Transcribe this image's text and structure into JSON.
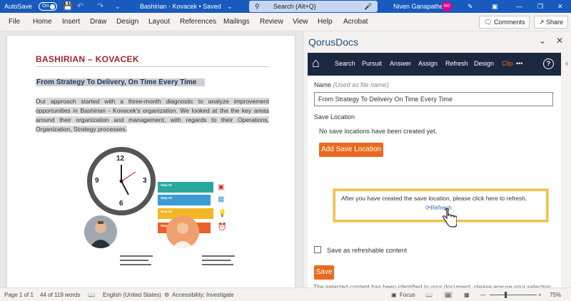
{
  "titlebar": {
    "autosave_label": "AutoSave",
    "autosave_state": "On",
    "doc_title": "Bashirian - Kovacek • Saved",
    "search_placeholder": "Search (Alt+Q)",
    "user_name": "Niven Ganapathee",
    "user_initials": "NG",
    "colors": {
      "bar": "#185abd",
      "avatar": "#e3008c"
    }
  },
  "menu": {
    "items": [
      "File",
      "Home",
      "Insert",
      "Draw",
      "Design",
      "Layout",
      "References",
      "Mailings",
      "Review",
      "View",
      "Help",
      "Acrobat"
    ],
    "comments_label": "Comments",
    "share_label": "Share"
  },
  "document": {
    "title": "BASHIRIAN – KOVACEK",
    "subheading": "From Strategy To Delivery, On Time Every Time",
    "paragraph": "Our approach started with a three-month diagnostic to analyze improvement opportunities in Bashirian - Kovacek's organization. We looked at the the key areas around their organization and management, with regards to their Operations, Organization, Strategy processes.",
    "clock_numbers": [
      "12",
      "3",
      "6",
      "9"
    ],
    "steps": [
      "Step 01",
      "Step 02",
      "Step 03",
      "Step 04"
    ],
    "step_colors": [
      "#2aa8a0",
      "#3a9bd5",
      "#f2b824",
      "#e9602d"
    ]
  },
  "pane": {
    "title": "QorusDocs",
    "nav": [
      "Search",
      "Pursuit",
      "Answer",
      "Assign",
      "Refresh",
      "Design",
      "Clip"
    ],
    "more_label": "•••",
    "help_label": "?",
    "name_label": "Name",
    "name_hint": "(Used as file name)",
    "name_value": "From Strategy To Delivery On Time Every Time",
    "save_location_label": "Save Location",
    "no_locations_text": "No save locations have been created yet.",
    "add_location_label": "Add Save Location",
    "refresh_message": "After you have created the save location, please click here to refresh.",
    "refresh_link": "Refresh",
    "refreshable_label": "Save as refreshable content",
    "save_label": "Save",
    "note": "The selected content has been identified in your document, please ensure your selection is correct before proceeding.",
    "colors": {
      "nav_bg": "#1c2740",
      "accent": "#e96a1f",
      "clip": "#e96a1f",
      "highlight": "#f2c14e"
    }
  },
  "status": {
    "page": "Page 1 of 1",
    "words": "44 of 119 words",
    "language": "English (United States)",
    "accessibility": "Accessibility: Investigate",
    "focus": "Focus",
    "zoom": "75%"
  }
}
